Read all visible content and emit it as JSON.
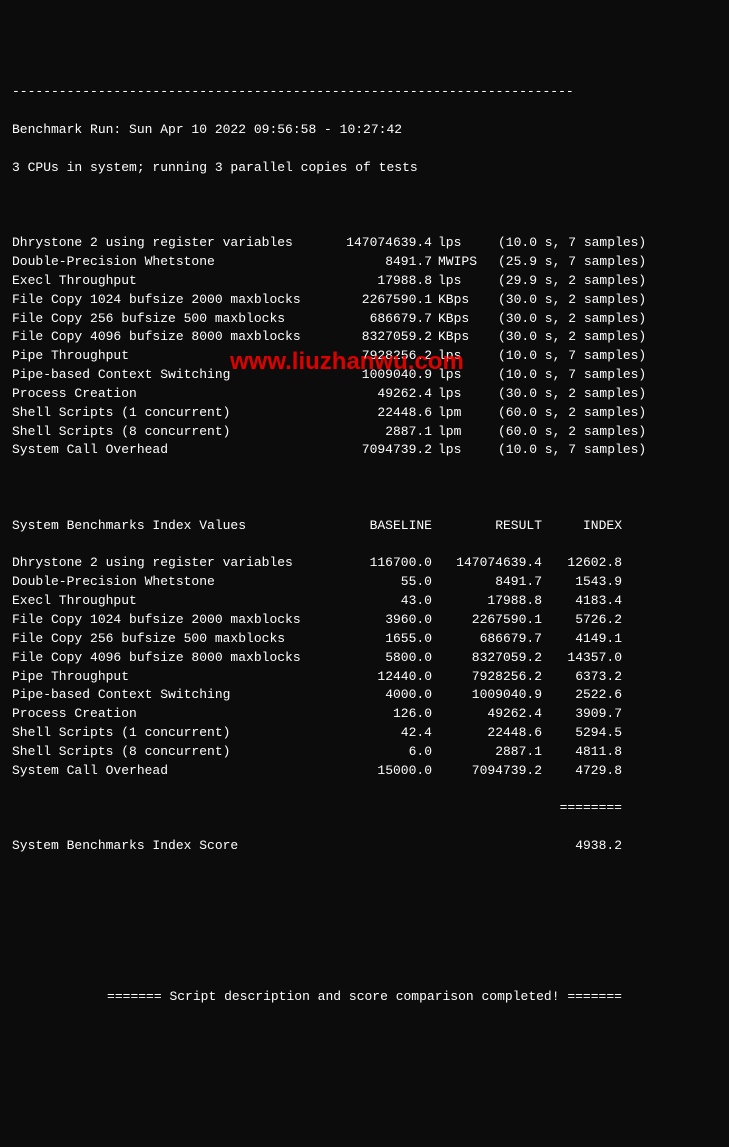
{
  "separator_top": "------------------------------------------------------------------------",
  "header": {
    "run_label": "Benchmark Run: Sun Apr 10 2022 09:56:58 - 10:27:42",
    "cpu_info": "3 CPUs in system; running 3 parallel copies of tests"
  },
  "tests": [
    {
      "name": "Dhrystone 2 using register variables",
      "value": "147074639.4",
      "unit": "lps",
      "timing": "(10.0 s, 7 samples)"
    },
    {
      "name": "Double-Precision Whetstone",
      "value": "8491.7",
      "unit": "MWIPS",
      "timing": "(25.9 s, 7 samples)"
    },
    {
      "name": "Execl Throughput",
      "value": "17988.8",
      "unit": "lps",
      "timing": "(29.9 s, 2 samples)"
    },
    {
      "name": "File Copy 1024 bufsize 2000 maxblocks",
      "value": "2267590.1",
      "unit": "KBps",
      "timing": "(30.0 s, 2 samples)"
    },
    {
      "name": "File Copy 256 bufsize 500 maxblocks",
      "value": "686679.7",
      "unit": "KBps",
      "timing": "(30.0 s, 2 samples)"
    },
    {
      "name": "File Copy 4096 bufsize 8000 maxblocks",
      "value": "8327059.2",
      "unit": "KBps",
      "timing": "(30.0 s, 2 samples)"
    },
    {
      "name": "Pipe Throughput",
      "value": "7928256.2",
      "unit": "lps",
      "timing": "(10.0 s, 7 samples)"
    },
    {
      "name": "Pipe-based Context Switching",
      "value": "1009040.9",
      "unit": "lps",
      "timing": "(10.0 s, 7 samples)"
    },
    {
      "name": "Process Creation",
      "value": "49262.4",
      "unit": "lps",
      "timing": "(30.0 s, 2 samples)"
    },
    {
      "name": "Shell Scripts (1 concurrent)",
      "value": "22448.6",
      "unit": "lpm",
      "timing": "(60.0 s, 2 samples)"
    },
    {
      "name": "Shell Scripts (8 concurrent)",
      "value": "2887.1",
      "unit": "lpm",
      "timing": "(60.0 s, 2 samples)"
    },
    {
      "name": "System Call Overhead",
      "value": "7094739.2",
      "unit": "lps",
      "timing": "(10.0 s, 7 samples)"
    }
  ],
  "index_header": {
    "title": "System Benchmarks Index Values",
    "baseline": "BASELINE",
    "result": "RESULT",
    "index": "INDEX"
  },
  "index_rows": [
    {
      "name": "Dhrystone 2 using register variables",
      "baseline": "116700.0",
      "result": "147074639.4",
      "index": "12602.8"
    },
    {
      "name": "Double-Precision Whetstone",
      "baseline": "55.0",
      "result": "8491.7",
      "index": "1543.9"
    },
    {
      "name": "Execl Throughput",
      "baseline": "43.0",
      "result": "17988.8",
      "index": "4183.4"
    },
    {
      "name": "File Copy 1024 bufsize 2000 maxblocks",
      "baseline": "3960.0",
      "result": "2267590.1",
      "index": "5726.2"
    },
    {
      "name": "File Copy 256 bufsize 500 maxblocks",
      "baseline": "1655.0",
      "result": "686679.7",
      "index": "4149.1"
    },
    {
      "name": "File Copy 4096 bufsize 8000 maxblocks",
      "baseline": "5800.0",
      "result": "8327059.2",
      "index": "14357.0"
    },
    {
      "name": "Pipe Throughput",
      "baseline": "12440.0",
      "result": "7928256.2",
      "index": "6373.2"
    },
    {
      "name": "Pipe-based Context Switching",
      "baseline": "4000.0",
      "result": "1009040.9",
      "index": "2522.6"
    },
    {
      "name": "Process Creation",
      "baseline": "126.0",
      "result": "49262.4",
      "index": "3909.7"
    },
    {
      "name": "Shell Scripts (1 concurrent)",
      "baseline": "42.4",
      "result": "22448.6",
      "index": "5294.5"
    },
    {
      "name": "Shell Scripts (8 concurrent)",
      "baseline": "6.0",
      "result": "2887.1",
      "index": "4811.8"
    },
    {
      "name": "System Call Overhead",
      "baseline": "15000.0",
      "result": "7094739.2",
      "index": "4729.8"
    }
  ],
  "separator_equals": "========",
  "score": {
    "label": "System Benchmarks Index Score",
    "value": "4938.2"
  },
  "footer": "======= Script description and score comparison completed! =======",
  "watermark": "www.liuzhanwu.com"
}
